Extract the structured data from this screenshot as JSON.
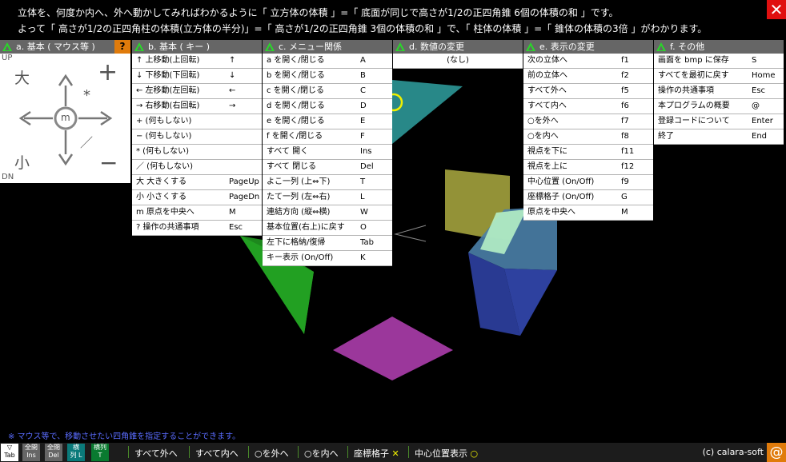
{
  "header": {
    "line1": "立体を、何度か内へ、外へ動かしてみればわかるように「 立方体の体積 」=「 底面が同じで高さが1/2の正四角錐  6個の体積の和 」です。",
    "line2": "よって「 高さが1/2の正四角柱の体積(立方体の半分)」=「 高さが1/2の正四角錐  3個の体積の和 」で、「 柱体の体積 」=「 錐体の体積の3倍 」がわかります。",
    "close": "✕"
  },
  "menu_a": {
    "title": "a. 基本 ( マウス等 )",
    "help": "?",
    "pad": {
      "up": "UP",
      "dn": "DN",
      "big": "大",
      "small": "小",
      "plus": "+",
      "minus": "−",
      "asterisk": "*",
      "slash": "／",
      "center": "m"
    }
  },
  "menu_b": {
    "title": "b. 基本 ( キー )",
    "items": [
      {
        "label": "↑  上移動(上回転)",
        "key": "↑"
      },
      {
        "label": "↓  下移動(下回転)",
        "key": "↓"
      },
      {
        "label": "←  左移動(左回転)",
        "key": "←"
      },
      {
        "label": "→  右移動(右回転)",
        "key": "→"
      },
      {
        "label": "+  (何もしない)",
        "key": ""
      },
      {
        "label": "−  (何もしない)",
        "key": ""
      },
      {
        "label": "*  (何もしない)",
        "key": ""
      },
      {
        "label": "／  (何もしない)",
        "key": ""
      },
      {
        "label": "大  大きくする",
        "key": "PageUp"
      },
      {
        "label": "小  小さくする",
        "key": "PageDn"
      },
      {
        "label": "m  原点を中央へ",
        "key": "M"
      },
      {
        "label": "?   操作の共通事項",
        "key": "Esc"
      }
    ]
  },
  "menu_c": {
    "title": "c. メニュー関係",
    "items": [
      {
        "label": "a を開く/閉じる",
        "key": "A"
      },
      {
        "label": "b を開く/閉じる",
        "key": "B"
      },
      {
        "label": "c を開く/閉じる",
        "key": "C"
      },
      {
        "label": "d を開く/閉じる",
        "key": "D"
      },
      {
        "label": "e を開く/閉じる",
        "key": "E"
      },
      {
        "label": "f を開く/閉じる",
        "key": "F"
      },
      {
        "label": "すべて 開く",
        "key": "Ins"
      },
      {
        "label": "すべて 閉じる",
        "key": "Del"
      },
      {
        "label": "よこ一列 (上⇔下)",
        "key": "T"
      },
      {
        "label": "たて一列 (左⇔右)",
        "key": "L"
      },
      {
        "label": "連結方向 (縦⇔横)",
        "key": "W"
      },
      {
        "label": "基本位置(右上)に戻す",
        "key": "O"
      },
      {
        "label": "左下に格納/復帰",
        "key": "Tab"
      },
      {
        "label": "キー表示 (On/Off)",
        "key": "K"
      }
    ]
  },
  "menu_d": {
    "title": "d. 数値の変更",
    "items": [
      {
        "label": "(なし)"
      }
    ]
  },
  "menu_e": {
    "title": "e. 表示の変更",
    "items": [
      {
        "label": "次の立体へ",
        "key": "f1"
      },
      {
        "label": "前の立体へ",
        "key": "f2"
      },
      {
        "label": "すべて外へ",
        "key": "f5"
      },
      {
        "label": "すべて内へ",
        "key": "f6"
      },
      {
        "label": "○を外へ",
        "key": "f7"
      },
      {
        "label": "○を内へ",
        "key": "f8"
      },
      {
        "label": "視点を下に",
        "key": "f11"
      },
      {
        "label": "視点を上に",
        "key": "f12"
      },
      {
        "label": "中心位置 (On/Off)",
        "key": "f9"
      },
      {
        "label": "座標格子 (On/Off)",
        "key": "G"
      },
      {
        "label": "原点を中央へ",
        "key": "M"
      }
    ]
  },
  "menu_f": {
    "title": "f. その他",
    "items": [
      {
        "label": "画面を bmp に保存",
        "key": "S"
      },
      {
        "label": "すべてを最初に戻す",
        "key": "Home"
      },
      {
        "label": "操作の共通事項",
        "key": "Esc"
      },
      {
        "label": "本プログラムの概要",
        "key": "@"
      },
      {
        "label": "登録コードについて",
        "key": "Enter"
      },
      {
        "label": "終了",
        "key": "End"
      }
    ]
  },
  "note": "※ マウス等で、移動させたい四角錐を指定することができます。",
  "bottom": {
    "tab": {
      "top": "▽",
      "bottom": "Tab"
    },
    "openall": {
      "top": "全開",
      "bottom": "Ins"
    },
    "closeall": {
      "top": "全閉",
      "bottom": "Del"
    },
    "yoko": {
      "top": "横",
      "bottom": "列 L"
    },
    "tate": {
      "top": "横列",
      "bottom": "T"
    },
    "items": [
      "すべて外へ",
      "すべて内へ",
      "○を外へ",
      "○を内へ",
      "座標格子",
      "中心位置表示"
    ],
    "grid_mark": "✕",
    "center_mark": "○",
    "copyright": "(c) calara-soft",
    "at": "@"
  },
  "colors": {
    "teal": "#2a8f8f",
    "green": "#1f8f1f",
    "olive": "#9b9a3a",
    "blue": "#2b3d9a",
    "steel": "#4a7fa8",
    "magenta": "#a33aa3",
    "lightgreen": "#b5f0c5",
    "yellow": "#f0f000"
  }
}
